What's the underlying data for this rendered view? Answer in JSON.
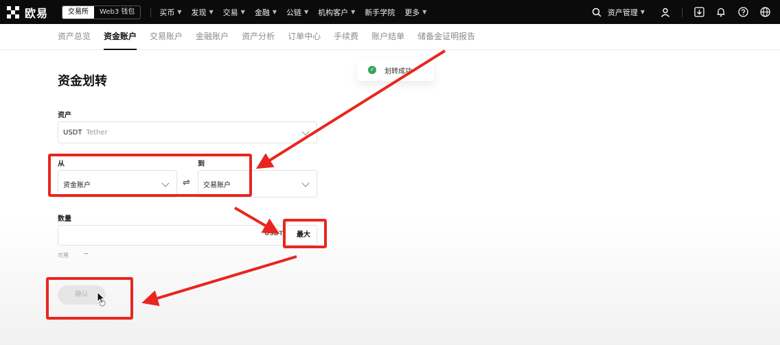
{
  "topbar": {
    "logo_text": "欧易",
    "mode_tabs": [
      "交易所",
      "Web3 钱包"
    ],
    "nav": [
      "买币",
      "发现",
      "交易",
      "金融",
      "公链",
      "机构客户",
      "新手学院",
      "更多"
    ],
    "nav_dropdown": [
      true,
      true,
      true,
      true,
      true,
      true,
      false,
      true
    ],
    "asset_mgmt": "资产管理",
    "icons": [
      "search-icon",
      "user-icon",
      "download-icon",
      "bell-icon",
      "help-icon",
      "globe-icon"
    ]
  },
  "subnav": {
    "tabs": [
      "资产总览",
      "资金账户",
      "交易账户",
      "金融账户",
      "资产分析",
      "订单中心",
      "手续费",
      "账户结单",
      "储备金证明报告"
    ],
    "active_index": 1
  },
  "page": {
    "title": "资金划转",
    "asset_label": "资产",
    "asset_value": "USDT",
    "asset_name": "Tether",
    "from_label": "从",
    "from_value": "资金账户",
    "to_label": "到",
    "to_value": "交易账户",
    "amount_label": "数量",
    "amount_value": "",
    "amount_unit": "USDT",
    "max_label": "最大",
    "available_label": "可用",
    "available_value": "--",
    "confirm_label": "确认"
  },
  "toast": {
    "message": "划转成功",
    "status": "success"
  },
  "colors": {
    "topbar_bg": "#0b0b0b",
    "annotation_red": "#e8261f",
    "success_green": "#3aa55b"
  }
}
